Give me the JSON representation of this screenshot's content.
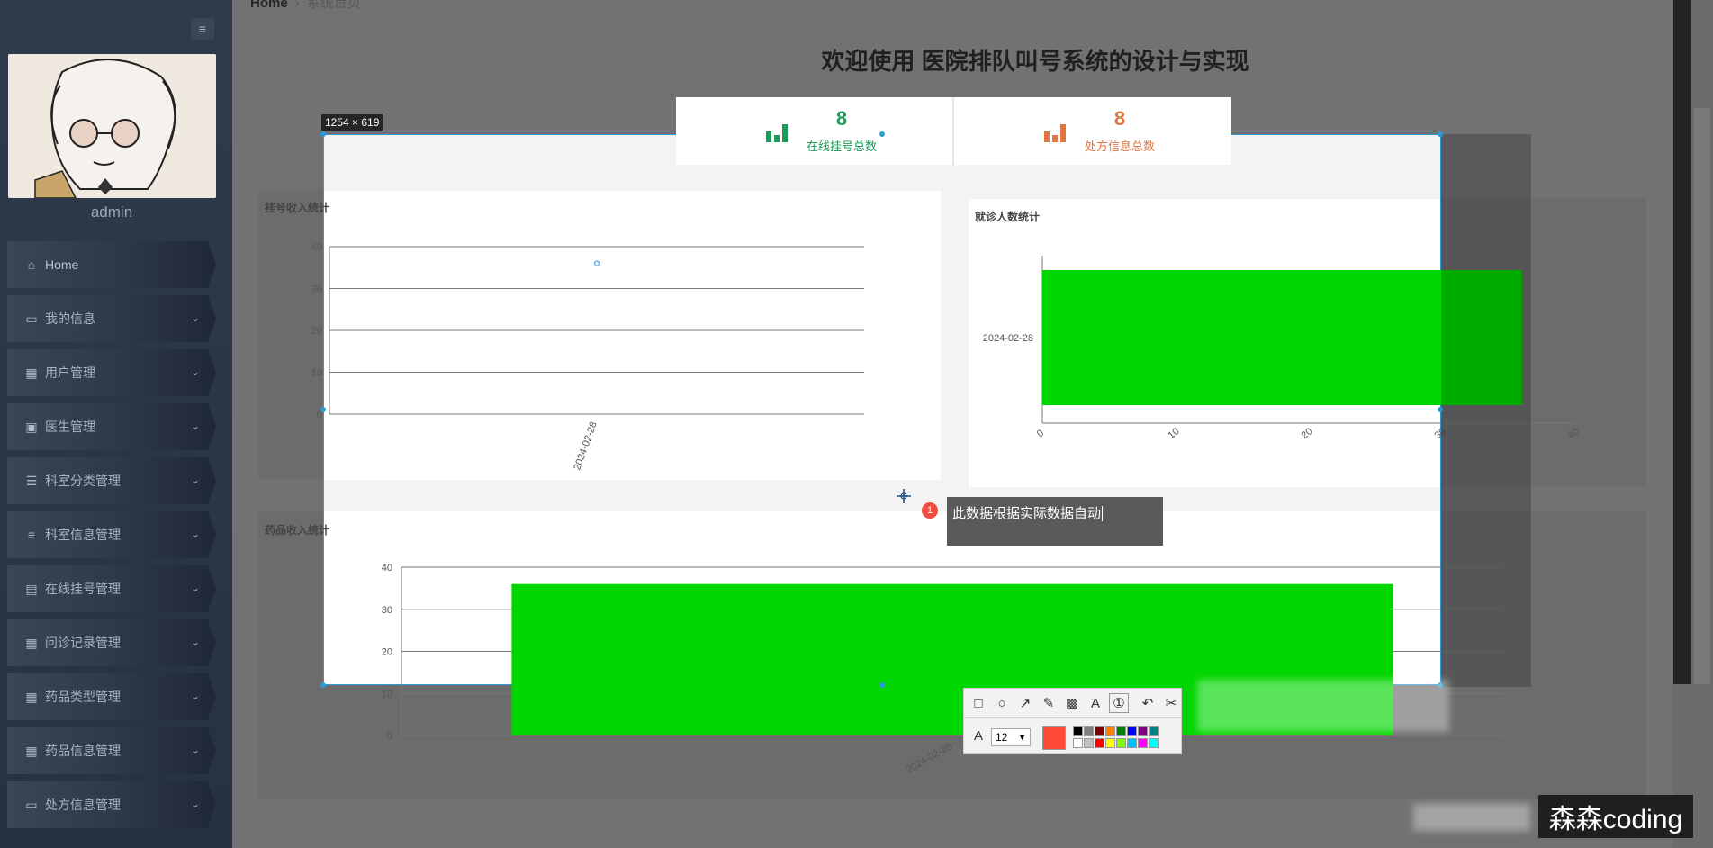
{
  "sidebar": {
    "username": "admin",
    "items": [
      {
        "label": "Home",
        "icon": "home-icon"
      },
      {
        "label": "我的信息",
        "icon": "profile-icon"
      },
      {
        "label": "用户管理",
        "icon": "grid-icon"
      },
      {
        "label": "医生管理",
        "icon": "doctor-icon"
      },
      {
        "label": "科室分类管理",
        "icon": "sliders-icon"
      },
      {
        "label": "科室信息管理",
        "icon": "list-icon"
      },
      {
        "label": "在线挂号管理",
        "icon": "clipboard-icon"
      },
      {
        "label": "问诊记录管理",
        "icon": "grid-icon"
      },
      {
        "label": "药品类型管理",
        "icon": "grid-icon"
      },
      {
        "label": "药品信息管理",
        "icon": "grid-icon"
      },
      {
        "label": "处方信息管理",
        "icon": "monitor-icon"
      }
    ]
  },
  "header": {
    "breadcrumb_home": "Home",
    "breadcrumb_current": "系统首页",
    "title": "欢迎使用 医院排队叫号系统的设计与实现"
  },
  "stats": [
    {
      "value": "8",
      "label": "在线挂号总数",
      "color": "#1e9b5a",
      "icon": "bar-chart-icon"
    },
    {
      "value": "8",
      "label": "处方信息总数",
      "color": "#e0763f",
      "icon": "bar-chart-icon"
    }
  ],
  "charts": {
    "registration_income_title": "挂号收入统计",
    "visits_title": "就诊人数统计",
    "drug_income_title": "药品收入统计"
  },
  "chart_data": [
    {
      "type": "scatter",
      "title": "挂号收入统计",
      "x": [
        "2024-02-28"
      ],
      "y": [
        36
      ],
      "ylim": [
        0,
        40
      ],
      "yticks": [
        0,
        10,
        20,
        30,
        40
      ],
      "grid": true
    },
    {
      "type": "bar",
      "orientation": "horizontal",
      "title": "就诊人数统计",
      "categories": [
        "2024-02-28"
      ],
      "values": [
        36
      ],
      "xlim": [
        0,
        40
      ],
      "xticks": [
        0,
        10,
        20,
        30,
        40
      ],
      "bar_color": "#00d600"
    },
    {
      "type": "bar",
      "title": "药品收入统计",
      "categories": [
        "2024-02-28"
      ],
      "values": [
        36
      ],
      "ylim": [
        0,
        40
      ],
      "yticks": [
        0,
        10,
        20,
        30,
        40
      ],
      "grid": true,
      "bar_color": "#00d600"
    }
  ],
  "screenshot_tool": {
    "size_label": "1254 × 619",
    "annotation_index": "1",
    "annotation_text": "此数据根据实际数据自动",
    "font_size": "12",
    "current_color": "#ff4a36",
    "palette": [
      "#000000",
      "#808080",
      "#800000",
      "#ff7f00",
      "#008000",
      "#0000ff",
      "#800080",
      "#008080",
      "#ffffff",
      "#c0c0c0",
      "#ff0000",
      "#ffff00",
      "#80ff00",
      "#00bfff",
      "#ff00ff",
      "#00ffff"
    ]
  },
  "watermark": "森森coding"
}
